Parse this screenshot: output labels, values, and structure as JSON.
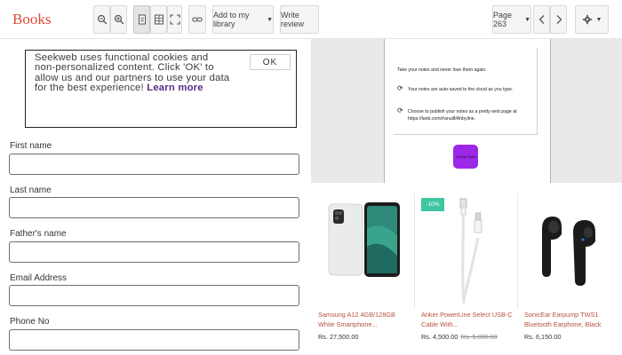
{
  "app": {
    "brand": "Books"
  },
  "toolbar": {
    "add_library_label": "Add to my library",
    "write_review_label": "Write review",
    "page_label": "Page 263"
  },
  "cookie": {
    "text": "Seekweb uses functional cookies and non-personalized content. Click 'OK' to allow us and our partners to use your data for the best experience!",
    "link": "Learn more",
    "ok": "OK"
  },
  "form": {
    "fields": [
      {
        "label": "First name",
        "value": ""
      },
      {
        "label": "Last name",
        "value": ""
      },
      {
        "label": "Father's name",
        "value": ""
      },
      {
        "label": "Email Address",
        "value": ""
      },
      {
        "label": "Phone No",
        "value": ""
      }
    ]
  },
  "book": {
    "line1": "Take your notes and never lose them again.",
    "line2": "Your notes are auto-saved to the cloud as you type.",
    "line3": "Choose to publish your notes as a pretty web page at",
    "line4": "https://lanb.com/#anuilf/Ahbyline.",
    "button": "Let me Start"
  },
  "products": [
    {
      "name": "Samsung A12 4GB/128GB White Smartphone...",
      "price": "Rs. 27,500.00",
      "old_price": ""
    },
    {
      "name": "Anker PowerLine Select USB-C Cable With...",
      "price": "Rs. 4,500.00",
      "old_price": "Rs. 5,000.00",
      "badge": "-10%"
    },
    {
      "name": "SonicEar Earpump TWS1 Bluetooth Earphone, Black",
      "price": "Rs. 6,150.00",
      "old_price": ""
    }
  ],
  "colors": {
    "brand": "#dd4b39",
    "product_name": "#b5523a",
    "badge": "#3ec6a2",
    "cta": "#9c27e8"
  }
}
